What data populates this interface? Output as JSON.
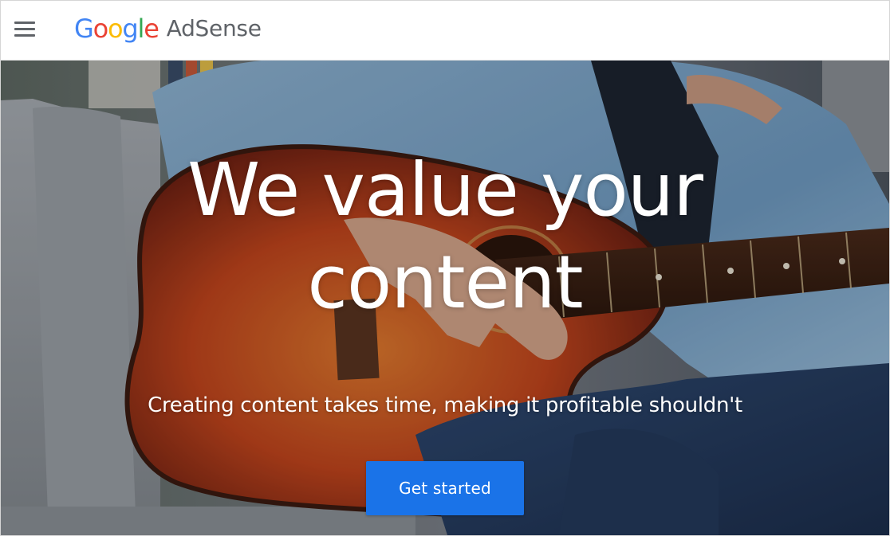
{
  "header": {
    "menu_icon": "hamburger-menu-icon",
    "logo": {
      "google_letters": [
        "G",
        "o",
        "o",
        "g",
        "l",
        "e"
      ],
      "product": "AdSense"
    }
  },
  "hero": {
    "image_description_icon": "guitar-player-photo",
    "headline_line1": "We value your",
    "headline_line2": "content",
    "subheadline": "Creating content takes time, making it profitable shouldn't",
    "cta_label": "Get started"
  },
  "colors": {
    "google_blue": "#4285f4",
    "google_red": "#ea4335",
    "google_yellow": "#fbbc05",
    "google_green": "#34a853",
    "product_grey": "#5f6368",
    "cta_blue": "#1a73e8"
  }
}
